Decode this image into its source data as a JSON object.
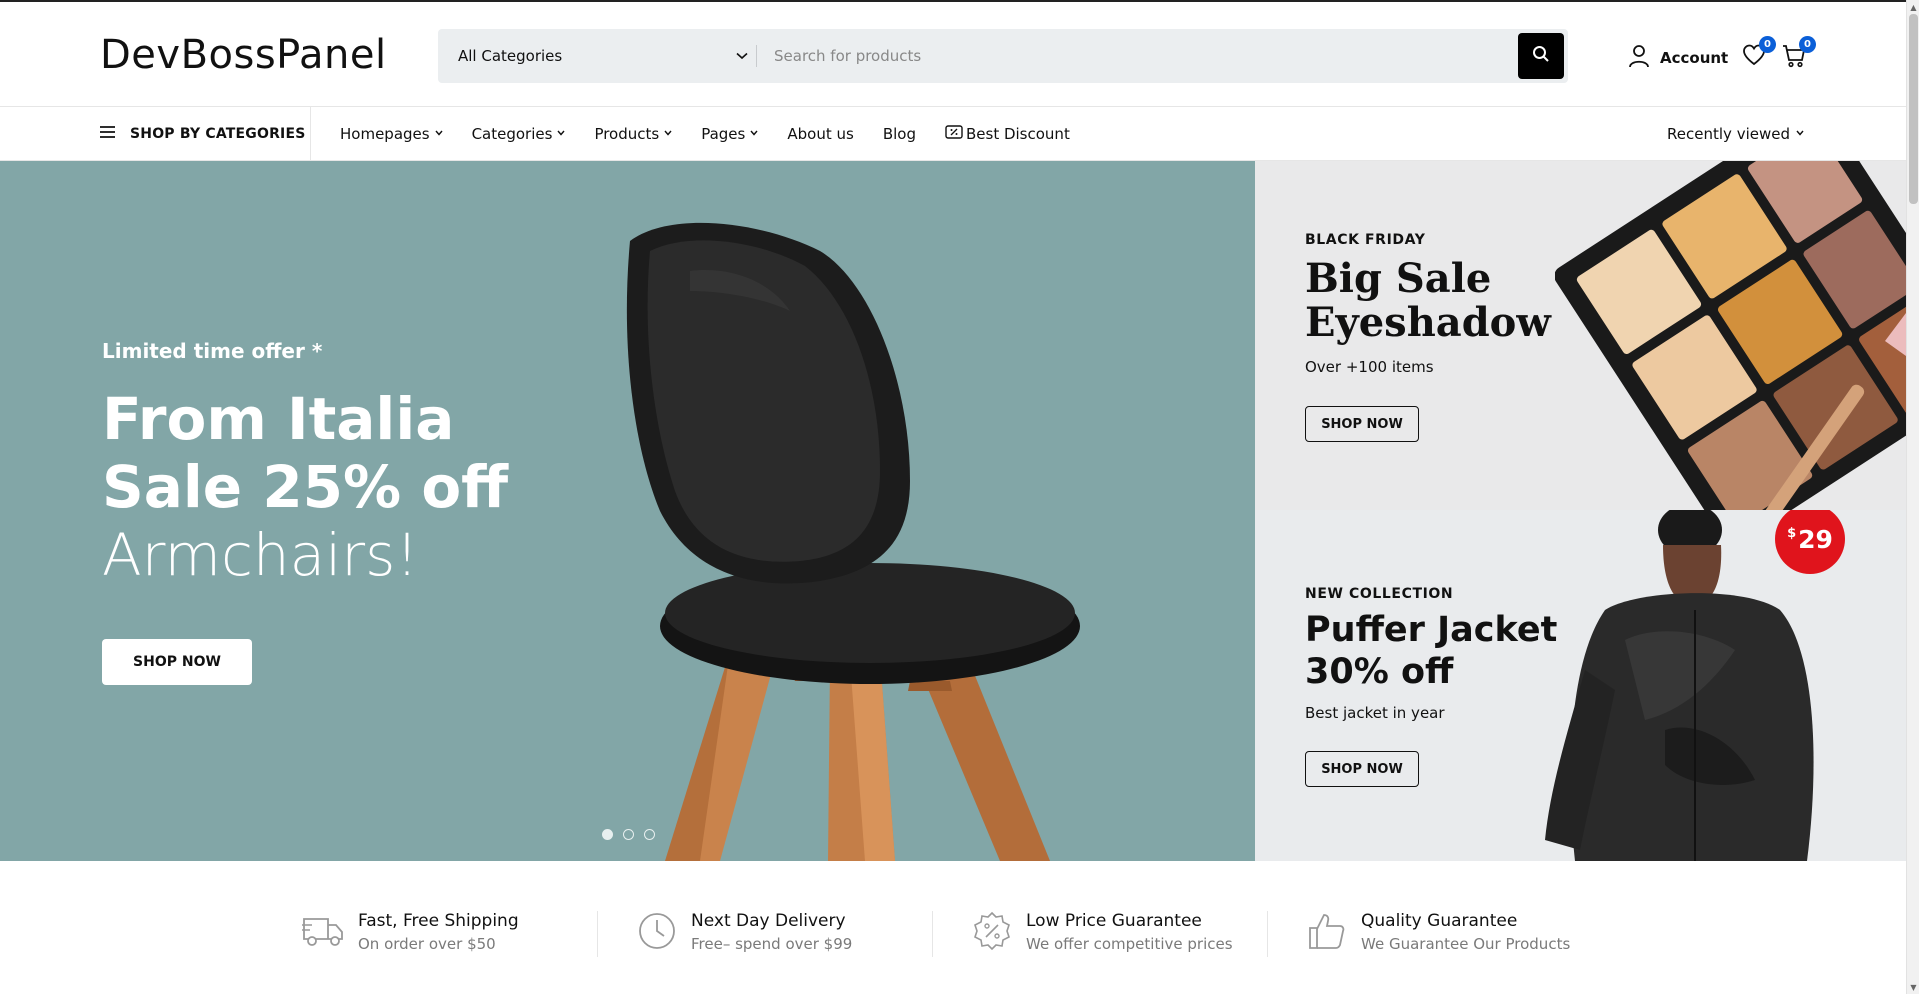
{
  "header": {
    "logo": "DevBossPanel",
    "category_select": "All Categories",
    "search_placeholder": "Search for products",
    "account_label": "Account",
    "wishlist_count": "0",
    "cart_count": "0"
  },
  "nav": {
    "shop_by": "SHOP BY CATEGORIES",
    "items": [
      {
        "label": "Homepages",
        "dropdown": true
      },
      {
        "label": "Categories",
        "dropdown": true
      },
      {
        "label": "Products",
        "dropdown": true
      },
      {
        "label": "Pages",
        "dropdown": true
      },
      {
        "label": "About us",
        "dropdown": false
      },
      {
        "label": "Blog",
        "dropdown": false
      }
    ],
    "best_discount": "Best Discount",
    "recently_viewed": "Recently viewed"
  },
  "hero": {
    "kicker": "Limited time offer *",
    "line1": "From Italia",
    "line2": "Sale 25% off",
    "line3": "Armchairs!",
    "button": "SHOP NOW",
    "background": "#82a6a7",
    "slide_count": 3,
    "active_slide": 1
  },
  "promo1": {
    "kicker": "BLACK FRIDAY",
    "title_line1": "Big Sale",
    "title_line2": "Eyeshadow",
    "subtitle": "Over +100 items",
    "button": "SHOP NOW"
  },
  "promo2": {
    "kicker": "NEW COLLECTION",
    "title_line1": "Puffer Jacket",
    "title_line2": "30% off",
    "subtitle": "Best jacket in year",
    "button": "SHOP NOW",
    "price_currency": "$",
    "price_value": "29",
    "price_color": "#e0141c"
  },
  "features": [
    {
      "icon": "truck-icon",
      "title": "Fast, Free Shipping",
      "subtitle": "On order over $50"
    },
    {
      "icon": "clock-icon",
      "title": "Next Day Delivery",
      "subtitle": "Free– spend over $99"
    },
    {
      "icon": "discount-badge-icon",
      "title": "Low Price Guarantee",
      "subtitle": "We offer competitive prices"
    },
    {
      "icon": "thumbs-up-icon",
      "title": "Quality Guarantee",
      "subtitle": "We Guarantee Our Products"
    }
  ],
  "colors": {
    "accent_badge": "#0b5fd8",
    "search_bg": "#ebeef0"
  }
}
